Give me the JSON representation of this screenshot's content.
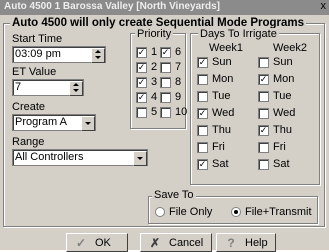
{
  "window": {
    "title": "Auto 4500 1 Barossa Valley [North Vineyards]",
    "close_glyph": "x"
  },
  "heading": "Auto 4500 will only create Sequential Mode Programs",
  "start_time": {
    "label": "Start Time",
    "value": "03:09 pm"
  },
  "et_value": {
    "label": "ET Value",
    "value": "7"
  },
  "create": {
    "label": "Create",
    "value": "Program A"
  },
  "range": {
    "label": "Range",
    "value": "All Controllers"
  },
  "priority": {
    "label": "Priority",
    "items": [
      {
        "label": "1",
        "checked": true
      },
      {
        "label": "6",
        "checked": true
      },
      {
        "label": "2",
        "checked": true
      },
      {
        "label": "7",
        "checked": false
      },
      {
        "label": "3",
        "checked": true
      },
      {
        "label": "8",
        "checked": false
      },
      {
        "label": "4",
        "checked": true
      },
      {
        "label": "9",
        "checked": false
      },
      {
        "label": "5",
        "checked": false
      },
      {
        "label": "10",
        "checked": false
      }
    ]
  },
  "days": {
    "label": "Days To Irrigate",
    "week1_label": "Week1",
    "week2_label": "Week2",
    "week1": [
      {
        "label": "Sun",
        "checked": true
      },
      {
        "label": "Mon",
        "checked": false
      },
      {
        "label": "Tue",
        "checked": false
      },
      {
        "label": "Wed",
        "checked": true
      },
      {
        "label": "Thu",
        "checked": false
      },
      {
        "label": "Fri",
        "checked": false
      },
      {
        "label": "Sat",
        "checked": true
      }
    ],
    "week2": [
      {
        "label": "Sun",
        "checked": false
      },
      {
        "label": "Mon",
        "checked": true
      },
      {
        "label": "Tue",
        "checked": false
      },
      {
        "label": "Wed",
        "checked": false
      },
      {
        "label": "Thu",
        "checked": true
      },
      {
        "label": "Fri",
        "checked": false
      },
      {
        "label": "Sat",
        "checked": false
      }
    ]
  },
  "save_to": {
    "label": "Save To",
    "options": [
      {
        "label": "File Only",
        "selected": false
      },
      {
        "label": "File+Transmit",
        "selected": true
      }
    ]
  },
  "buttons": {
    "ok": "OK",
    "cancel": "Cancel",
    "help": "Help"
  },
  "icons": {
    "ok": "check-icon",
    "cancel": "x-icon",
    "help": "question-icon",
    "ok_color": "#808080",
    "cancel_color": "#404040",
    "help_color": "#808080"
  }
}
